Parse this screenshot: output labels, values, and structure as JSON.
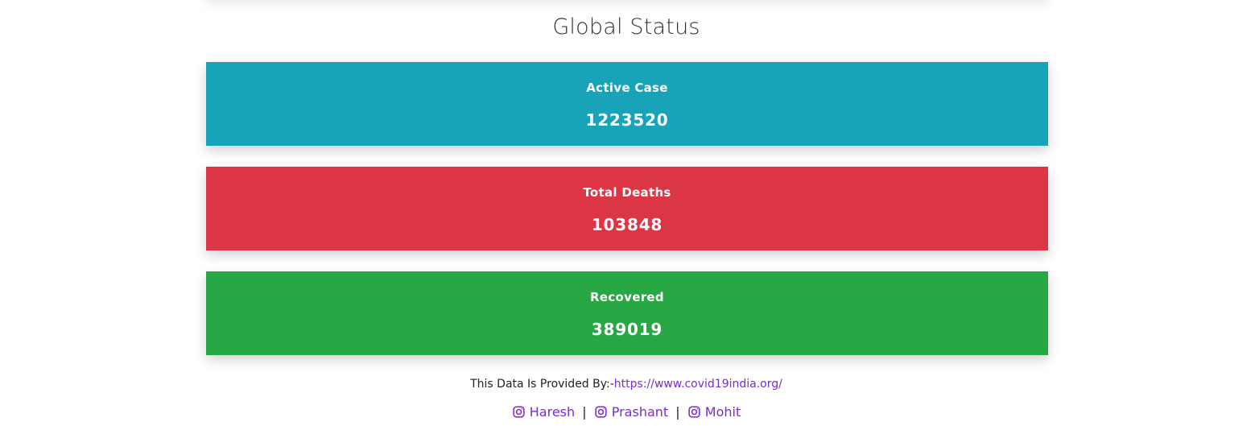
{
  "title": "Global Status",
  "colors": {
    "active": "#19a3b8",
    "deaths": "#dc3545",
    "recovered": "#28a745",
    "link": "#7b2bd1"
  },
  "stats": {
    "active": {
      "label": "Active Case",
      "value": "1223520"
    },
    "deaths": {
      "label": "Total Deaths",
      "value": "103848"
    },
    "recovered": {
      "label": "Recovered",
      "value": "389019"
    }
  },
  "footer": {
    "source_prefix": "This Data Is Provided By:-",
    "source_link": "https://www.covid19india.org/",
    "separator": "|",
    "authors": [
      {
        "name": "Haresh",
        "icon": "instagram-icon"
      },
      {
        "name": "Prashant",
        "icon": "instagram-icon"
      },
      {
        "name": "Mohit",
        "icon": "instagram-icon"
      }
    ]
  }
}
